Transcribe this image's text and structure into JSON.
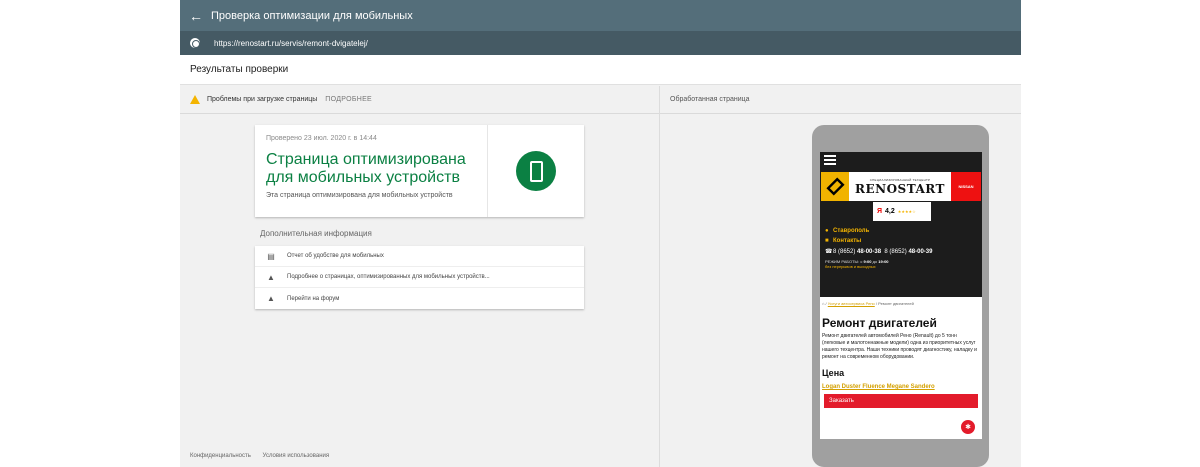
{
  "header": {
    "back_icon": "arrow-back-icon",
    "title": "Проверка оптимизации для мобильных"
  },
  "urlbar": {
    "globe_icon": "globe-icon",
    "url": "https://renostart.ru/servis/remont-dvigatelej/"
  },
  "results": {
    "title": "Результаты проверки"
  },
  "left_panel": {
    "issues": {
      "icon": "warning-icon",
      "label": "Проблемы при загрузке страницы",
      "more": "ПОДРОБНЕЕ"
    },
    "status_card": {
      "checked": "Проверено 23 июл. 2020 г. в 14:44",
      "headline": "Страница оптимизирована для мобильных устройств",
      "subtitle": "Эта страница оптимизирована для мобильных устройств",
      "status_color": "#0b8043",
      "icon": "smartphone-icon"
    },
    "additional": {
      "title": "Дополнительная информация",
      "items": [
        {
          "icon": "window-icon",
          "label": "Отчет об удобстве для мобильных"
        },
        {
          "icon": "school-icon",
          "label": "Подробнее о страницах, оптимизированных для мобильных устройств..."
        },
        {
          "icon": "school-icon",
          "label": "Перейти на форум"
        }
      ]
    },
    "footer": {
      "privacy": "Конфиденциальность",
      "terms": "Условия использования"
    }
  },
  "right_panel": {
    "title": "Обработанная страница",
    "site": {
      "brand_small": "СПЕЦИАЛИЗИРОВАННЫЙ ТЕХЦЕНТР",
      "brand": "RENOSTART",
      "nissan": "NISSAN",
      "rating_logo": "Я",
      "rating_value": "4,2",
      "rating_stars": "★★★★☆",
      "city": "Ставрополь",
      "contacts": "Контакты",
      "phone_code1": "8 (8652)",
      "phone_num1": "48-00-38",
      "phone_code2": "8 (8652)",
      "phone_num2": "48-00-39",
      "hours_label": "РЕЖИМ РАБОТЫ:",
      "hours_from": "с",
      "hours_open": "9:00",
      "hours_to": "до",
      "hours_close": "19:00",
      "days_off": "без перерывов и выходных",
      "crumb_service": "Услуги автосервиса Рено",
      "crumb_sep": "/",
      "crumb_current": "Ремонт двигателей",
      "heading": "Ремонт двигателей",
      "body": "Ремонт двигателей автомобилей Рено (Renault) до 5 тонн (легковые и малотоннажные модели) одна из приоритетных услуг нашего техцентра. Наши техники проводят диагностику, наладку и ремонт на современном оборудовании.",
      "price_heading": "Цена",
      "models": "Logan Duster Fluence Megane Sandero",
      "order": "Заказать"
    }
  }
}
